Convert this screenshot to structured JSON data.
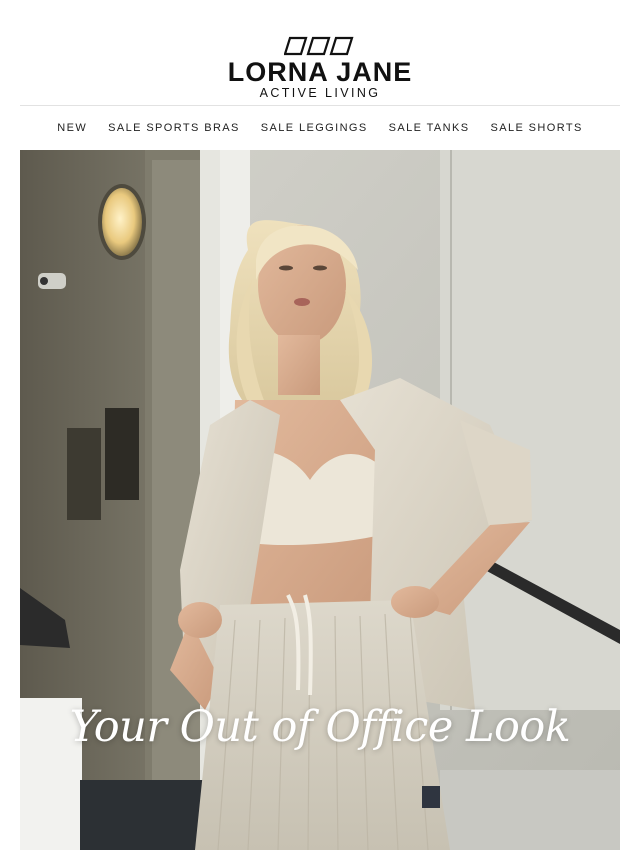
{
  "brand": {
    "name": "LORNA JANE",
    "tagline": "ACTIVE LIVING"
  },
  "nav": {
    "items": [
      {
        "label": "NEW"
      },
      {
        "label": "SALE SPORTS BRAS"
      },
      {
        "label": "SALE LEGGINGS"
      },
      {
        "label": "SALE TANKS"
      },
      {
        "label": "SALE SHORTS"
      }
    ]
  },
  "hero": {
    "headline": "Your Out of Office Look"
  },
  "colors": {
    "text": "#111111",
    "divider": "#e2e2e2",
    "headline": "#ffffff"
  }
}
